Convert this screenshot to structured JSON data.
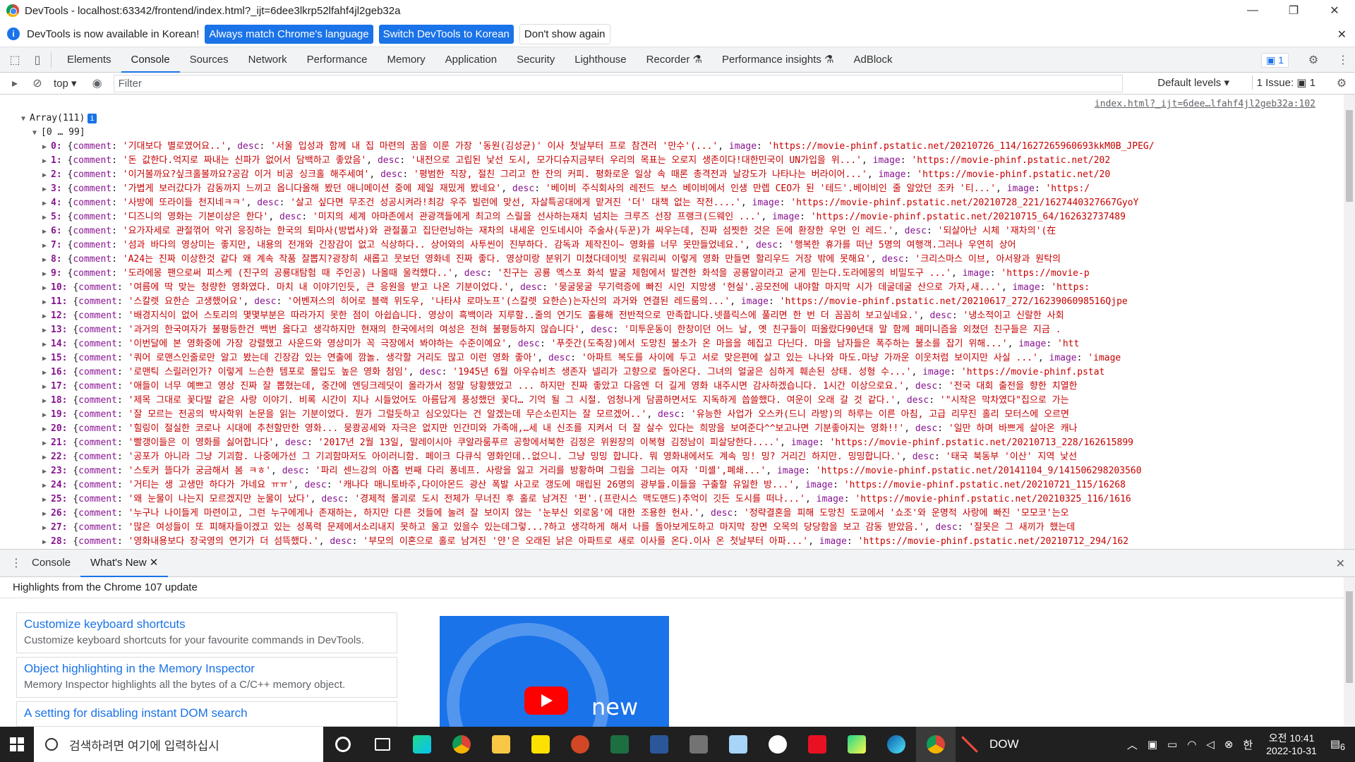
{
  "window": {
    "title": "DevTools - localhost:63342/frontend/index.html?_ijt=6dee3lkrp52lfahf4jl2geb32a",
    "minimize": "—",
    "maximize": "❐",
    "close": "✕"
  },
  "infobar": {
    "message": "DevTools is now available in Korean!",
    "btn_match": "Always match Chrome's language",
    "btn_switch": "Switch DevTools to Korean",
    "btn_dismiss": "Don't show again"
  },
  "tabs": [
    "Elements",
    "Console",
    "Sources",
    "Network",
    "Performance",
    "Memory",
    "Application",
    "Security",
    "Lighthouse",
    "Recorder ⚗",
    "Performance insights ⚗",
    "AdBlock"
  ],
  "active_tab": "Console",
  "msg_count": "▣ 1",
  "console_toolbar": {
    "context": "top ▾",
    "filter_placeholder": "Filter",
    "levels": "Default levels ▾",
    "issues": "1 Issue: ▣ 1"
  },
  "console": {
    "source_link": "index.html?_ijt=6dee…lfahf4jl2geb32a:102",
    "array_label": "Array(111)",
    "range_label": "[0 … 99]",
    "rows": [
      {
        "i": "0",
        "comment": "'기대보다 별로였어요..'",
        "desc": "'서울 입성과 함께 내 집 마련의 꿈을 이룬 가장 '동원(김성균)' 이사 첫날부터 프로 참견러 '만수'(...'",
        "image": "'https://movie-phinf.pstatic.net/20210726_114/1627265960693kkM0B_JPEG/"
      },
      {
        "i": "1",
        "comment": "'돈 값한다.억지로 짜내는 신파가 없어서 담백하고 좋았음'",
        "desc": "'내전으로 고립된 낯선 도시, 모가디슈지금부터 우리의 목표는 오로지 생존이다!대한민국이 UN가입을 위...'",
        "image": "'https://movie-phinf.pstatic.net/202"
      },
      {
        "i": "2",
        "comment": "'이거볼까요?싶크홀볼까요?공감 이거 비공 싱크홀 해주세여'",
        "desc": "'평범한 직장, 절친 그리고 한 잔의 커피. 평화로운 일상 속 때론 총격전과 날강도가 나타나는 버라이어...'",
        "image": "'https://movie-phinf.pstatic.net/20"
      },
      {
        "i": "3",
        "comment": "'가볍게 보러갔다가 감동까지 느끼고 옵니다올해 봤던 애니메이션 중에 제일 재밌게 봤네요'",
        "desc": "'베이비 주식회사의 레전드 보스 베이비에서 인생 만렙 CEO가 된 '테드'.베이비인 줄 알았던 조카 '티...'",
        "image": "'https:/"
      },
      {
        "i": "4",
        "comment": "'사방에 또라이들 천지네ㅋㅋ'",
        "desc": "'살고 싶다면 무조건 성공시켜라!최강 우주 빌런에 맞선, 자살특공대에게 맡겨진 '더' 대책 없는 작전....'",
        "image": "'https://movie-phinf.pstatic.net/20210728_221/1627440327667GyoY"
      },
      {
        "i": "5",
        "comment": "'디즈니의 영화는 기본이상은 한다'",
        "desc": "'미지의 세계 아마존에서 관광객들에게 최고의 스릴을 선사하는재치 넘치는 크루즈 선장 프랭크(드웨인 ...'",
        "image": "'https://movie-phinf.pstatic.net/20210715_64/162632737489"
      },
      {
        "i": "6",
        "comment": "'요가자세로 관절꺾어 악귀 응징하는  한국의 퇴마사(방법사)와 관절풀고 집단런닝하는 재차의 내세운 인도네시아 주술사(두꾼)가 싸우는데, 진짜 섬찟한 것은 돈에 환장한 우먼 인 레드.'",
        "desc": "'되살아난 시체 '재차의'(在",
        "image": ""
      },
      {
        "i": "7",
        "comment": "'섬과  바다의 영상미는  좋지만,  내용의 전개와  긴장감이  없고  식상하다.. 상어와의 사투씬이 진부하다. 감독과  제작진이~ 영화를  너무  못만들었네요.'",
        "desc": "'행복한 휴가를 떠난 5명의 여행객.그러나 우연히 상어",
        "image": ""
      },
      {
        "i": "8",
        "comment": "'A24는 진짜 이상한것 같다 왜 계속 작품 잘뽑지?광장히 새롭고 뭇보던 영화네 진짜 좋다. 영상미랑 분위기 미쳤다데이빗 로워리씨 이렇게 영화 만들면 할리우드 거장 밖에 못해요'",
        "desc": "'크리스마스 이브, 아서왕과 원탁의",
        "image": ""
      },
      {
        "i": "9",
        "comment": "'도라에몽 팬으로써 피스케 (진구의 공룡대탐험 때 주인공) 나올때 울컥했다..'",
        "desc": "'진구는 공룡 엑스포 화석 발굴 체험에서 발견한 화석을 공룡알이라고 굳게 믿는다.도라에몽의 비밀도구 ...'",
        "image": "'https://movie-p"
      },
      {
        "i": "10",
        "comment": "'여름에 딱 맞는 청량한 영화였다. 마치 내 이야기인듯, 큰 응원을 받고 나온 기분이었다.'",
        "desc": "'뭉굴뭉굴 무기력증에 빠진 시인 지망생 '현실'.공모전에 내야할 마지막 시가 데굴데굴 산으로 가자,새...'",
        "image": "'https:"
      },
      {
        "i": "11",
        "comment": "'스칼렛 요한슨  고생했어요'",
        "desc": "'어벤져스의 히어로 블랙 위도우, '나타샤 로마노프'(스칼렛 요한슨)는자신의 과거와 연결된 레드룸의...'",
        "image": "'https://movie-phinf.pstatic.net/20210617_272/1623906098516Qjpe"
      },
      {
        "i": "12",
        "comment": "'배경지식이 없어 스토리의 몇몇부분은 따라가지 못한 점이 아쉽습니다. 영상이 흑백이라 지루할..줄의 연기도 훌륭해 전반적으로 만족합니다.넷플릭스에 풀리면 한 번 더 꼼꼼히 보고싶네요.'",
        "desc": "'냉소적이고 신랄한 사회",
        "image": ""
      },
      {
        "i": "13",
        "comment": "'과거의 한국여자가 불평등한건 백번 옳다고 생각하지만 현재의 한국에서의 여성은 전혀 불평등하지 않습니다'",
        "desc": "'미투운동이 한창이던 어느 날, 옛 친구들이 떠올랐다90년대 말 함께 페미니즘을 외쳤던 친구들은 지금 .",
        "image": ""
      },
      {
        "i": "14",
        "comment": "'이번달에 본 영화중에 가장 강렬했고 사운드와 영상미가 꼭 극장에서 봐야하는 수준이예요'",
        "desc": "'푸줏간(도축장)에서 도망친 불소가 온 마을을 헤집고 다닌다. 마을 남자들은 폭주하는 불소를 잡기 위해...'",
        "image": "'htt"
      },
      {
        "i": "15",
        "comment": "'쿼어 로맨스인줄로만 알고 봤는데 긴장감 있는 연출에 깜놀. 생각할 거리도 많고 이런 영화 좋아'",
        "desc": "'아파트 복도를 사이에 두고 서로 맞은편에 살고 있는 나나와 마도.마냥 가까운 이웃처럼 보이지만 사실 ...'",
        "image": "'image"
      },
      {
        "i": "16",
        "comment": "'로맨틱 스릴러인가?  이렇게 느슨한 템포로 몰입도 높은 영화 첨임'",
        "desc": "'1945년 6월 아우슈비츠 생존자 넬리가 고향으로 돌아온다. 그녀의 얼굴은 심하게 훼손된 상태. 성형 수...'",
        "image": "'https://movie-phinf.pstat"
      },
      {
        "i": "17",
        "comment": "'애들이 너무 예쁘고 영상 진짜 잘 뽑혔는데, 중간에 엔딩크레딧이 올라가서 정말 당황했었고 ... 하지만 진짜 좋았고 다음엔 더 길게 영화 내주시면 감사하겠습니다. 1시간 이상으로요.'",
        "desc": "'전국 대회 출전을 향한 치열한",
        "image": ""
      },
      {
        "i": "18",
        "comment": "'제목 그대로 꽃다발 같은 사랑 이야기. 비록 시간이 지나 시들었어도 아름답게 풍성했던 꽃다… 기억 될 그 시절. 엄청나게 담콤하면서도 지독하게 씁쓸했다. 여운이 오래 갈 것 같다.'",
        "desc": "'\"시작은 막차였다\"집으로 가는",
        "image": ""
      },
      {
        "i": "19",
        "comment": "'잘 모르는 전공의 박사학위 논문을 읽는 기분이었다. 뭔가 그럴듯하고 심오있다는 건 알겠는데 무슨소린지는 잘 모르겠어..'",
        "desc": "'유능한 사업가 오스카(드니 라방)의 하루는 이른 아침, 고급 리무진 홀리 모터스에 오르면",
        "image": ""
      },
      {
        "i": "20",
        "comment": "'힐링이 절실한 코로나 시대에 추천할만한 영화... 뭉쾅공세와 자극은 없지만 인간미와 가족애,…세 내 신조를 지켜서 더 잘 살수 있다는 희망을 보여준다^^보고나면 기분좋아지는 영화!!'",
        "desc": "'일만 하며 바쁘게 살아온 캐나",
        "image": ""
      },
      {
        "i": "21",
        "comment": "'빨갱이들은 이 영화를 싫어합니다'",
        "desc": "'2017년 2월 13일, 말레이시아 쿠알라룸푸르 공항에서북한 김정은 위원장의 이복형 김정남이 피살당한다....'",
        "image": "'https://movie-phinf.pstatic.net/20210713_228/162615899"
      },
      {
        "i": "22",
        "comment": "'공포가 아니라 그냥 기괴함. 나중에가선 그 기괴함마저도 아이러니함. 페이크 다큐식 영화인데..없으니. 그냥 밍밍 합니다. 뭐 영화내에서도 계속 밍! 밍? 거리긴 하지만. 밍밍합니다.'",
        "desc": "'태국 북동부 '이산' 지역 낯선",
        "image": ""
      },
      {
        "i": "23",
        "comment": "'스토커 뜰다가 궁금해서 봄 ㅋㅎ'",
        "desc": "'파리 센느강의 아홉 번째 다리 퐁네프. 사랑을 잃고 거리를 방황하며 그림을 그리는 여자 '미셸',폐쇄...'",
        "image": "'https://movie-phinf.pstatic.net/20141104_9/141506298203560"
      },
      {
        "i": "24",
        "comment": "'거티는 생 고생만 하다가 가네요 ㅠㅠ'",
        "desc": "'캐나다 매니토바주,다이아몬드 광산 폭발 사고로 갱도에 매립된 26명의 광부들.이들을 구출할 유일한 방...'",
        "image": "'https://movie-phinf.pstatic.net/20210721_115/16268"
      },
      {
        "i": "25",
        "comment": "'왜 눈물이 나는지 모르겠지만 눈물이 났다'",
        "desc": "'경제적 몰괴로 도시 전체가 무너진 후 홀로 남겨진 '펀'.(프란시스 맥도맨드)추억이 깃든 도시를 떠나...'",
        "image": "'https://movie-phinf.pstatic.net/20210325_116/1616"
      },
      {
        "i": "26",
        "comment": "'누구나 나이들게 마련이고, 그런 누구에게나 존재하는, 하지만 다른 것들에 눌려 잘 보이지 않는 '눈부신 외로움'에 대한 조용한 헌사.'",
        "desc": "'정략결혼을 피해 도망친 도쿄에서 '쇼조'와 운명적 사랑에 빠진 '모모코'는오",
        "image": ""
      },
      {
        "i": "27",
        "comment": "'많은 여성들이 또 피해자들이겠고 있는 성폭력 문제에서소리내지 못하고 울고 있을수 있는데그렇...?하고 생각하게 해서 나를 돌아보게도하고 마지막 장면 오목의 당당함을 보고 감동 받았음.'",
        "desc": "'잘못은 그 새끼가 했는데",
        "image": ""
      },
      {
        "i": "28",
        "comment": "'영화내용보다 장국영의 연기가 더 섬뜩했다.'",
        "desc": "'부모의 이혼으로 홀로 남겨진 '얀'은 오래된 낡은 아파트로 새로 이사를 온다.이사 온 첫날부터 아파...'",
        "image": "'https://movie-phinf.pstatic.net/20210712_294/162"
      }
    ]
  },
  "drawer": {
    "tabs": [
      "Console",
      "What's New"
    ],
    "active": "What's New",
    "header": "Highlights from the Chrome 107 update",
    "cards": [
      {
        "title": "Customize keyboard shortcuts",
        "desc": "Customize keyboard shortcuts for your favourite commands in DevTools."
      },
      {
        "title": "Object highlighting in the Memory Inspector",
        "desc": "Memory Inspector highlights all the bytes of a C/C++ memory object."
      },
      {
        "title": "A setting for disabling instant DOM search",
        "desc": ""
      }
    ],
    "video_text": "new"
  },
  "taskbar": {
    "search_placeholder": "검색하려면 여기에 입력하십시",
    "stock": "DOW",
    "ime": "한",
    "time": "오전 10:41",
    "date": "2022-10-31",
    "notif_count": "6"
  }
}
